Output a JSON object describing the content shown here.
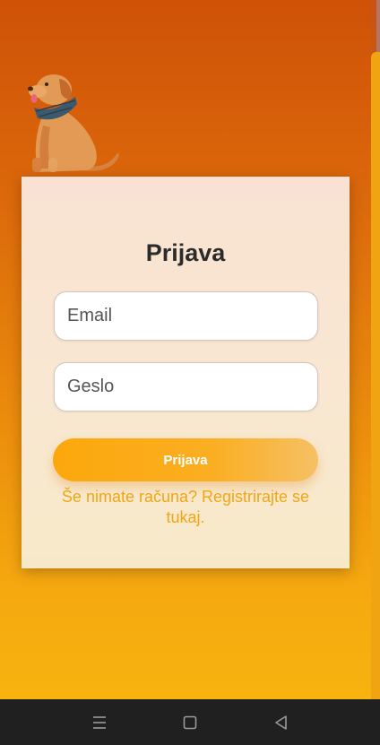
{
  "login": {
    "title": "Prijava",
    "email_placeholder": "Email",
    "password_placeholder": "Geslo",
    "submit_label": "Prijava",
    "register_link": "Še nimate računa? Registrirajte se tukaj."
  },
  "icons": {
    "mascot": "dog-mascot-icon",
    "nav_menu": "menu-icon",
    "nav_home": "home-icon",
    "nav_back": "back-icon"
  },
  "colors": {
    "background_top": "#cf5208",
    "background_bottom": "#f7b30f",
    "card": "#f9e4d2",
    "accent": "#fca80c",
    "link": "#f2a514",
    "title": "#2b2b2b"
  }
}
